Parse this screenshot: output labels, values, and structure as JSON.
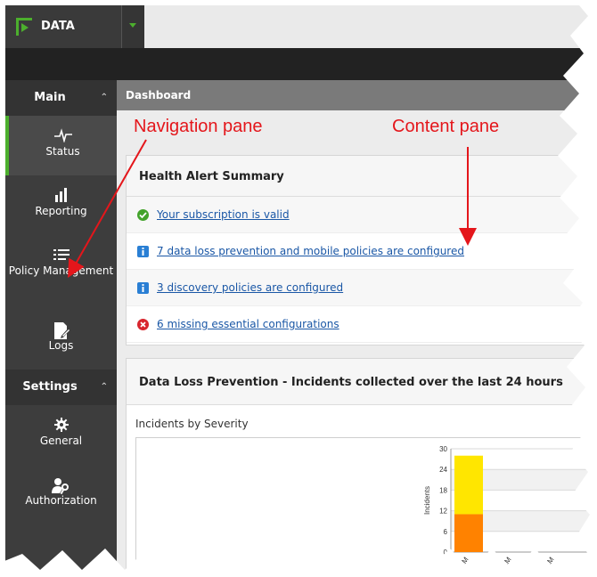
{
  "brand": {
    "title": "DATA",
    "accent": "#4caf2d"
  },
  "sidebar": {
    "sections": [
      {
        "label": "Main",
        "items": [
          {
            "label": "Status",
            "icon": "pulse-icon"
          },
          {
            "label": "Reporting",
            "icon": "bar-chart-icon"
          },
          {
            "label": "Policy Management",
            "icon": "list-icon"
          },
          {
            "label": "Logs",
            "icon": "log-edit-icon"
          }
        ]
      },
      {
        "label": "Settings",
        "items": [
          {
            "label": "General",
            "icon": "gear-icon"
          },
          {
            "label": "Authorization",
            "icon": "user-key-icon"
          }
        ]
      }
    ],
    "active_item": "Status"
  },
  "content": {
    "breadcrumb": "Dashboard",
    "health": {
      "title": "Health Alert Summary",
      "alerts": [
        {
          "icon": "check-circle-icon",
          "text": "Your subscription is valid"
        },
        {
          "icon": "info-icon",
          "text": "7 data loss prevention and mobile policies are configured"
        },
        {
          "icon": "info-icon",
          "text": "3 discovery policies are configured"
        },
        {
          "icon": "error-icon",
          "text": "6 missing essential configurations"
        }
      ]
    },
    "dlp": {
      "title": "Data Loss Prevention - Incidents collected over the last 24 hours",
      "subtitle": "Incidents by Severity"
    }
  },
  "annotations": {
    "navigation": "Navigation pane",
    "content": "Content pane"
  },
  "chart_data": {
    "type": "bar",
    "title": "",
    "ylabel": "Incidents",
    "xlabel": "",
    "ylim": [
      0,
      30
    ],
    "yticks": [
      0,
      6,
      12,
      18,
      24,
      30
    ],
    "categories": [
      "11-3 AM",
      "3-7 AM",
      "7-11 AM",
      "11-3 PM",
      "3-7 PM"
    ],
    "series": [
      {
        "color": "#ff8200",
        "values": [
          11,
          0,
          0,
          0,
          0
        ]
      },
      {
        "color": "#ffe600",
        "values": [
          17,
          0,
          0,
          0,
          0
        ]
      }
    ]
  }
}
